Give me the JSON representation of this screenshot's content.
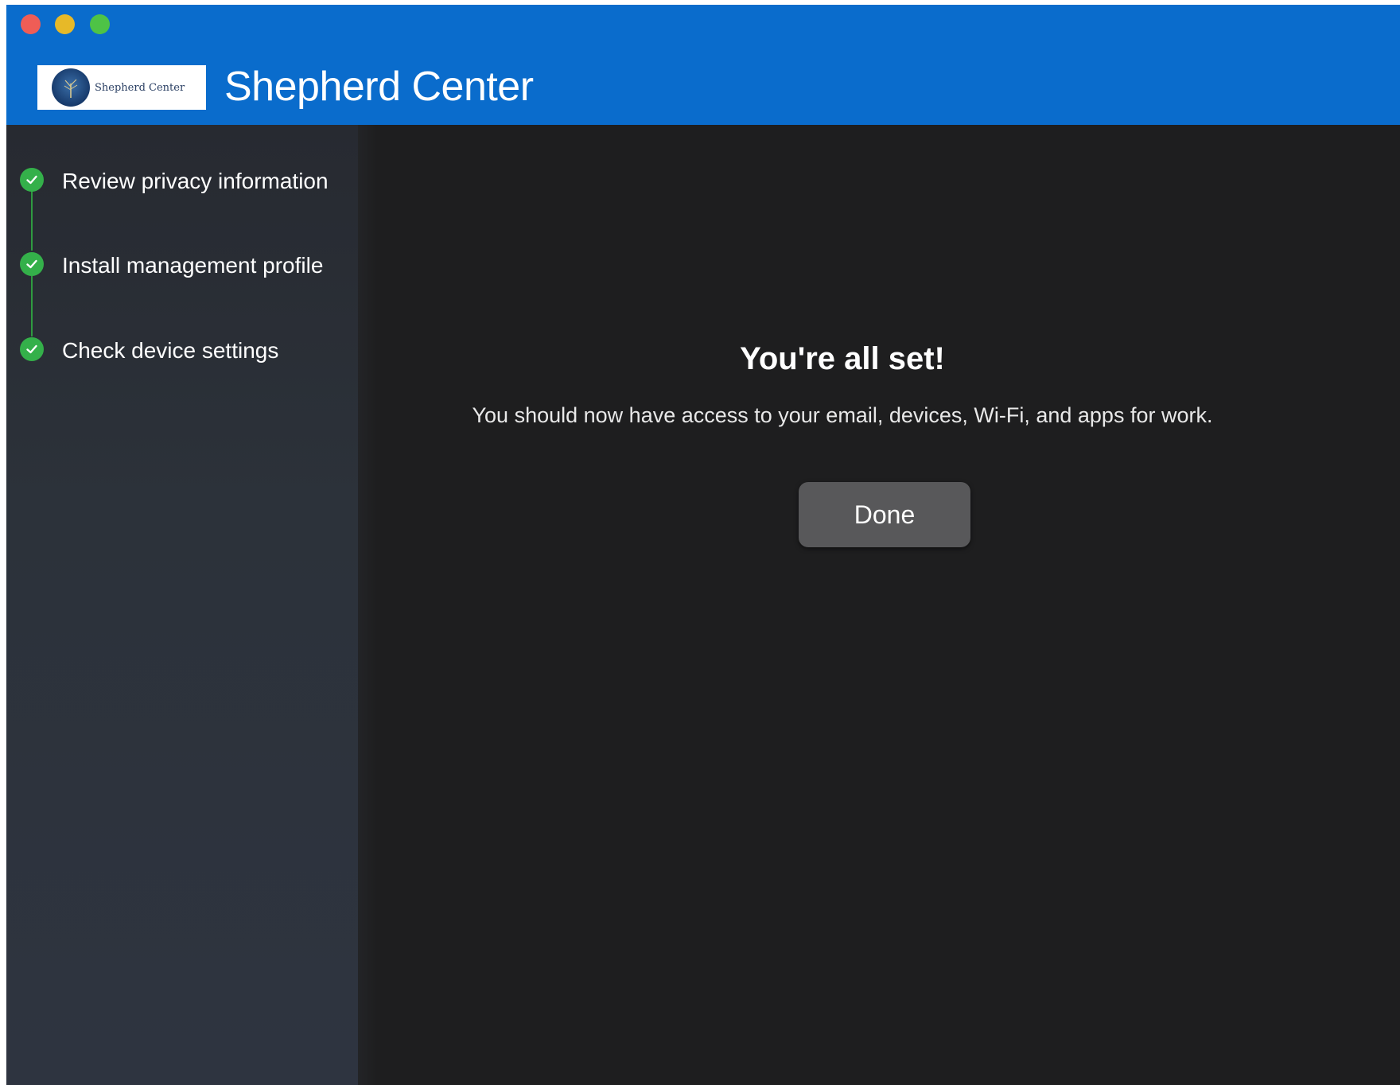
{
  "window": {
    "title": "Shepherd Center",
    "logo_text": "Shepherd Center"
  },
  "steps": [
    {
      "label": "Review privacy information",
      "status": "complete",
      "icon": "checkmark-icon"
    },
    {
      "label": "Install management profile",
      "status": "complete",
      "icon": "checkmark-icon"
    },
    {
      "label": "Check device settings",
      "status": "complete",
      "icon": "checkmark-icon"
    }
  ],
  "main": {
    "headline": "You're all set!",
    "message": "You should now have access to your email, devices, Wi-Fi, and apps for work.",
    "done_label": "Done"
  },
  "colors": {
    "titlebar": "#0a6ccc",
    "check_green": "#34b04a",
    "background": "#1e1e1f"
  }
}
